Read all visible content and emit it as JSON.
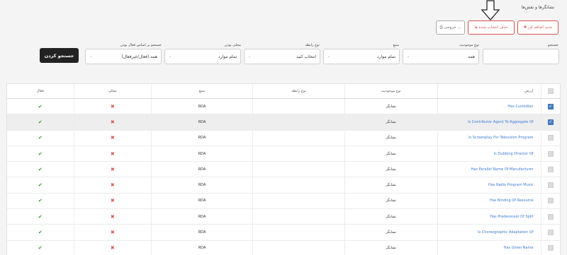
{
  "page_title": "نشانگرها و نقش‌ها",
  "toolbar": {
    "add_label": "✚ جدید اضافه کن",
    "delete_label": "حذف انتخاب شده ها",
    "export_label": "⎙ خروجی ..."
  },
  "filters": {
    "search_label": "جستجو",
    "search_value": "",
    "entity_type_label": "نوع موجودیت",
    "entity_type_value": "همه",
    "source_label": "منبع",
    "source_value": "تمام موارد",
    "relation_type_label": "نوع رابطه",
    "relation_type_value": "انتخاب کنید",
    "local_label": "محلی بودن",
    "local_value": "تمام موارد",
    "active_search_label": "جستجو بر اساس فعال بودن",
    "active_value": "همه (فعال/غیرفعال)",
    "search_button": "جستجو کردن"
  },
  "table": {
    "headers": {
      "value": "ارزش",
      "entity_type": "نوع موجودیت",
      "relation_type": "نوع رابطه",
      "source": "منبع",
      "local": "محلی",
      "active": "فعال"
    },
    "rows": [
      {
        "value": "Has Custodian",
        "entity_type": "نشانگر",
        "relation_type": "",
        "source": "RDA",
        "local": "✖",
        "active": "✔",
        "checked": "✓"
      },
      {
        "value": "Is Contributor Agent To Aggregate Of",
        "entity_type": "نشانگر",
        "relation_type": "",
        "source": "RDA",
        "local": "✖",
        "active": "✔",
        "checked": "✓"
      },
      {
        "value": "Is Screenplay For Television Program",
        "entity_type": "نشانگر",
        "relation_type": "",
        "source": "RDA",
        "local": "✖",
        "active": "✔",
        "checked": ""
      },
      {
        "value": "Is Dubbing Director Of",
        "entity_type": "نشانگر",
        "relation_type": "",
        "source": "RDA",
        "local": "✖",
        "active": "✔",
        "checked": ""
      },
      {
        "value": "Has Parallel Name Of Manufacturer",
        "entity_type": "نشانگر",
        "relation_type": "",
        "source": "RDA",
        "local": "✖",
        "active": "✔",
        "checked": ""
      },
      {
        "value": "Has Radio Program Music",
        "entity_type": "نشانگر",
        "relation_type": "",
        "source": "RDA",
        "local": "✖",
        "active": "✔",
        "checked": ""
      },
      {
        "value": "Has Binding Of Resource",
        "entity_type": "نشانگر",
        "relation_type": "",
        "source": "RDA",
        "local": "✖",
        "active": "✔",
        "checked": ""
      },
      {
        "value": "Has Predecessor Of Split",
        "entity_type": "نشانگر",
        "relation_type": "",
        "source": "RDA",
        "local": "✖",
        "active": "✔",
        "checked": ""
      },
      {
        "value": "Is Choreographic Adaptation Of",
        "entity_type": "نشانگر",
        "relation_type": "",
        "source": "RDA",
        "local": "✖",
        "active": "✔",
        "checked": ""
      },
      {
        "value": "Has Given Name",
        "entity_type": "نشانگر",
        "relation_type": "",
        "source": "RDA",
        "local": "✖",
        "active": "✔",
        "checked": ""
      }
    ]
  },
  "colors": {
    "accent_red": "#d9534f",
    "link_blue": "#3a7bd5",
    "check_green": "#2a9d2a",
    "selected_blue": "#4a7fc1"
  }
}
